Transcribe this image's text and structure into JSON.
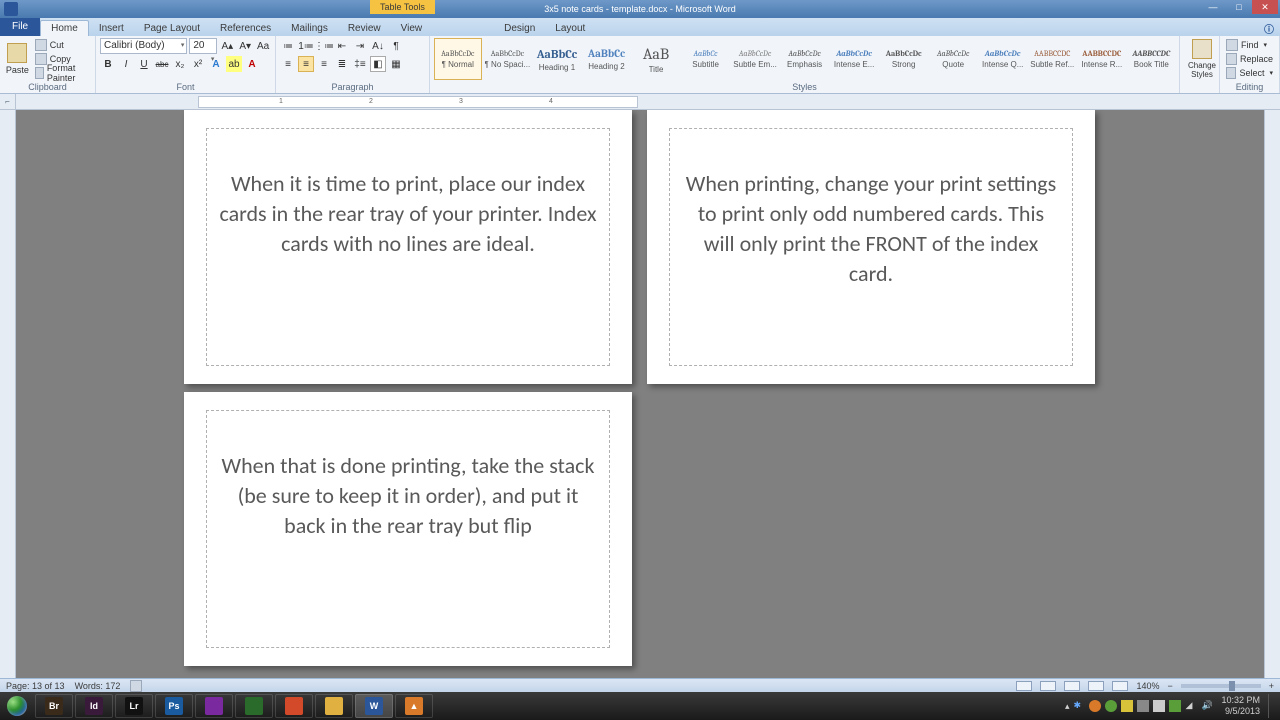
{
  "title": {
    "tabtools": "Table Tools",
    "document": "3x5 note cards - template.docx - Microsoft Word"
  },
  "tabs": {
    "file": "File",
    "list": [
      "Home",
      "Insert",
      "Page Layout",
      "References",
      "Mailings",
      "Review",
      "View"
    ],
    "ctx": [
      "Design",
      "Layout"
    ]
  },
  "clipboard": {
    "name": "Clipboard",
    "paste": "Paste",
    "cut": "Cut",
    "copy": "Copy",
    "fmtpainter": "Format Painter"
  },
  "font": {
    "name": "Font",
    "family": "Calibri (Body)",
    "size": "20",
    "bold": "B",
    "italic": "I",
    "underline": "U",
    "strike": "abc"
  },
  "paragraph": {
    "name": "Paragraph"
  },
  "styles": {
    "name": "Styles",
    "change": "Change Styles",
    "list": [
      {
        "prev": "AaBbCcDc",
        "name": "¶ Normal",
        "sel": true,
        "cls": ""
      },
      {
        "prev": "AaBbCcDc",
        "name": "¶ No Spaci...",
        "cls": ""
      },
      {
        "prev": "AaBbCc",
        "name": "Heading 1",
        "cls": "color:#365f91;font-size:12px;font-weight:bold"
      },
      {
        "prev": "AaBbCc",
        "name": "Heading 2",
        "cls": "color:#4f81bd;font-size:11px;font-weight:bold"
      },
      {
        "prev": "AaB",
        "name": "Title",
        "cls": "font-size:16px"
      },
      {
        "prev": "AaBbCc",
        "name": "Subtitle",
        "cls": "color:#4f81bd;font-style:italic"
      },
      {
        "prev": "AaBbCcDc",
        "name": "Subtle Em...",
        "cls": "color:#808080;font-style:italic"
      },
      {
        "prev": "AaBbCcDc",
        "name": "Emphasis",
        "cls": "font-style:italic"
      },
      {
        "prev": "AaBbCcDc",
        "name": "Intense E...",
        "cls": "color:#4f81bd;font-style:italic;font-weight:bold"
      },
      {
        "prev": "AaBbCcDc",
        "name": "Strong",
        "cls": "font-weight:bold"
      },
      {
        "prev": "AaBbCcDc",
        "name": "Quote",
        "cls": "font-style:italic"
      },
      {
        "prev": "AaBbCcDc",
        "name": "Intense Q...",
        "cls": "color:#4f81bd;font-style:italic;font-weight:bold"
      },
      {
        "prev": "AABBCCDC",
        "name": "Subtle Ref...",
        "cls": "color:#9b5e3c;font-size:8px"
      },
      {
        "prev": "AABBCCDC",
        "name": "Intense R...",
        "cls": "color:#9b5e3c;font-weight:bold;font-size:8px"
      },
      {
        "prev": "AABBCCDC",
        "name": "Book Title",
        "cls": "font-weight:bold;font-style:italic;font-size:8px"
      }
    ]
  },
  "editing": {
    "name": "Editing",
    "find": "Find",
    "replace": "Replace",
    "select": "Select"
  },
  "ruler": {
    "marks": [
      "1",
      "2",
      "3",
      "4"
    ]
  },
  "cards": [
    "When it is time to print, place our index cards in the rear tray of your printer.  Index cards with no lines are ideal.",
    "When printing, change your print settings to print only odd numbered cards.  This will only print the FRONT of the index card.",
    "When that is done printing, take the stack (be sure to keep it in order), and put it back in the rear tray but flip"
  ],
  "status": {
    "page": "Page: 13 of 13",
    "words": "Words: 172",
    "zoom": "140%"
  },
  "taskbar": {
    "apps": [
      {
        "bg": "#3a2a1a",
        "txt": "Br"
      },
      {
        "bg": "#3a1a3a",
        "txt": "Id"
      },
      {
        "bg": "#111",
        "txt": "Lr"
      },
      {
        "bg": "#1a5a9e",
        "txt": "Ps"
      },
      {
        "bg": "#7a2a9e",
        "txt": ""
      },
      {
        "bg": "#2a6a2a",
        "txt": ""
      },
      {
        "bg": "#d24a2a",
        "txt": ""
      },
      {
        "bg": "#e0b040",
        "txt": ""
      },
      {
        "bg": "#2b579a",
        "txt": "W",
        "active": true
      },
      {
        "bg": "#d87a2a",
        "txt": "▲"
      }
    ],
    "time": "10:32 PM",
    "date": "9/5/2013"
  }
}
